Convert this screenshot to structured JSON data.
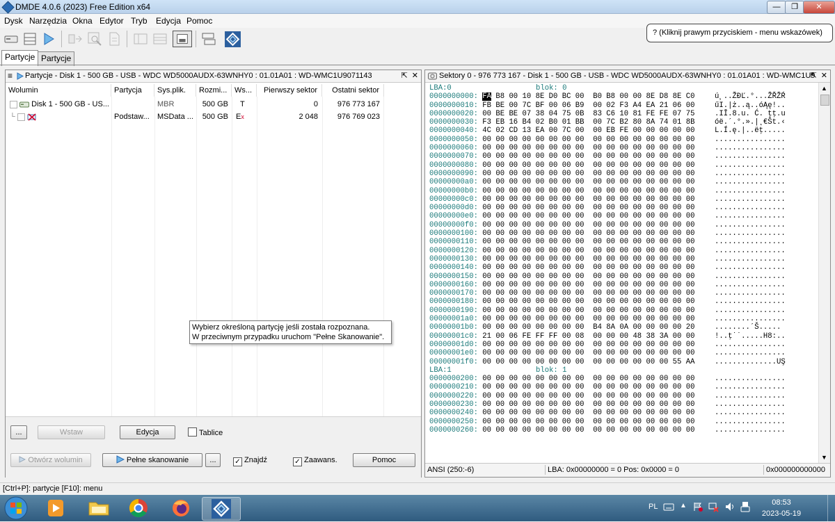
{
  "window": {
    "title": "DMDE 4.0.6 (2023) Free Edition x64",
    "close_label": "✕",
    "min_label": "—",
    "max_label": "❐"
  },
  "menu": [
    "Dysk",
    "Narzędzia",
    "Okna",
    "Edytor",
    "Tryb",
    "Edycja",
    "Pomoc"
  ],
  "hint": "? (Kliknij prawym przyciskiem - menu wskazówek)",
  "tabs": [
    "Partycje",
    "Partycje"
  ],
  "left_panel": {
    "title": "Partycje - Disk 1 - 500 GB - USB - WDC WD5000AUDX-63WNHY0 : 01.01A01 : WD-WMC1U9071143",
    "columns": [
      "Wolumin",
      "Partycja",
      "Sys.plik.",
      "Rozmi...",
      "Ws...",
      "Pierwszy sektor",
      "Ostatni sektor"
    ],
    "rows": [
      {
        "volume": "Disk 1 - 500 GB - US...",
        "partition": "",
        "fs": "MBR",
        "size": "500 GB",
        "ws": "T",
        "first": "0",
        "last": "976 773 167"
      },
      {
        "volume": "",
        "partition": "Podstaw...",
        "fs": "MSData ...",
        "size": "500 GB",
        "ws": "E",
        "ws_mark": "x",
        "first": "2 048",
        "last": "976 769 023"
      }
    ],
    "buttons": {
      "more1": "...",
      "insert": "Wstaw",
      "edit": "Edycja",
      "tables": "Tablice",
      "open_volume": "Otwórz wolumin",
      "full_scan": "Pełne skanowanie",
      "more2": "...",
      "find": "Znajdź",
      "advanced": "Zaawans.",
      "help": "Pomoc"
    }
  },
  "tooltip": {
    "line1": "Wybierz określoną partycję jeśli została rozpoznana.",
    "line2": "W przeciwnym przypadku uruchom \"Pełne Skanowanie\"."
  },
  "right_panel": {
    "title": "Sektory 0 - 976 773 167 - Disk 1 - 500 GB - USB - WDC WD5000AUDX-63WNHY0 : 01.01A01 : WD-WMC1U9...",
    "lba0_label": "LBA:0",
    "blok0_label": "blok: 0",
    "lba1_label": "LBA:1",
    "blok1_label": "blok: 1",
    "hex_rows": [
      {
        "off": "0000000000:",
        "hex": "FA B8 00 10 8E D0 BC 00  B0 B8 00 00 8E D8 8E C0",
        "ascii": "ú¸..ŽĐĽ.°...ŽŘŽŔ"
      },
      {
        "off": "0000000010:",
        "hex": "FB BE 00 7C BF 00 06 B9  00 02 F3 A4 EA 21 06 00",
        "ascii": "űI.|ż..ą..óĄę!.."
      },
      {
        "off": "0000000020:",
        "hex": "00 BE BE 07 38 04 75 0B  83 C6 10 81 FE FE 07 75",
        "ascii": ".IĪ.8.u. Ć. ţţ.u"
      },
      {
        "off": "0000000030:",
        "hex": "F3 EB 16 B4 02 B0 01 BB  00 7C B2 80 8A 74 01 8B",
        "ascii": "óë.´.°.».|˛€Št.‹"
      },
      {
        "off": "0000000040:",
        "hex": "4C 02 CD 13 EA 00 7C 00  00 EB FE 00 00 00 00 00",
        "ascii": "L.Í.ę.|..ëţ....."
      },
      {
        "off": "0000000050:",
        "hex": "00 00 00 00 00 00 00 00  00 00 00 00 00 00 00 00",
        "ascii": "................"
      },
      {
        "off": "0000000060:",
        "hex": "00 00 00 00 00 00 00 00  00 00 00 00 00 00 00 00",
        "ascii": "................"
      },
      {
        "off": "0000000070:",
        "hex": "00 00 00 00 00 00 00 00  00 00 00 00 00 00 00 00",
        "ascii": "................"
      },
      {
        "off": "0000000080:",
        "hex": "00 00 00 00 00 00 00 00  00 00 00 00 00 00 00 00",
        "ascii": "................"
      },
      {
        "off": "0000000090:",
        "hex": "00 00 00 00 00 00 00 00  00 00 00 00 00 00 00 00",
        "ascii": "................"
      },
      {
        "off": "00000000a0:",
        "hex": "00 00 00 00 00 00 00 00  00 00 00 00 00 00 00 00",
        "ascii": "................"
      },
      {
        "off": "00000000b0:",
        "hex": "00 00 00 00 00 00 00 00  00 00 00 00 00 00 00 00",
        "ascii": "................"
      },
      {
        "off": "00000000c0:",
        "hex": "00 00 00 00 00 00 00 00  00 00 00 00 00 00 00 00",
        "ascii": "................"
      },
      {
        "off": "00000000d0:",
        "hex": "00 00 00 00 00 00 00 00  00 00 00 00 00 00 00 00",
        "ascii": "................"
      },
      {
        "off": "00000000e0:",
        "hex": "00 00 00 00 00 00 00 00  00 00 00 00 00 00 00 00",
        "ascii": "................"
      },
      {
        "off": "00000000f0:",
        "hex": "00 00 00 00 00 00 00 00  00 00 00 00 00 00 00 00",
        "ascii": "................"
      },
      {
        "off": "0000000100:",
        "hex": "00 00 00 00 00 00 00 00  00 00 00 00 00 00 00 00",
        "ascii": "................"
      },
      {
        "off": "0000000110:",
        "hex": "00 00 00 00 00 00 00 00  00 00 00 00 00 00 00 00",
        "ascii": "................"
      },
      {
        "off": "0000000120:",
        "hex": "00 00 00 00 00 00 00 00  00 00 00 00 00 00 00 00",
        "ascii": "................"
      },
      {
        "off": "0000000130:",
        "hex": "00 00 00 00 00 00 00 00  00 00 00 00 00 00 00 00",
        "ascii": "................"
      },
      {
        "off": "0000000140:",
        "hex": "00 00 00 00 00 00 00 00  00 00 00 00 00 00 00 00",
        "ascii": "................"
      },
      {
        "off": "0000000150:",
        "hex": "00 00 00 00 00 00 00 00  00 00 00 00 00 00 00 00",
        "ascii": "................"
      },
      {
        "off": "0000000160:",
        "hex": "00 00 00 00 00 00 00 00  00 00 00 00 00 00 00 00",
        "ascii": "................"
      },
      {
        "off": "0000000170:",
        "hex": "00 00 00 00 00 00 00 00  00 00 00 00 00 00 00 00",
        "ascii": "................"
      },
      {
        "off": "0000000180:",
        "hex": "00 00 00 00 00 00 00 00  00 00 00 00 00 00 00 00",
        "ascii": "................"
      },
      {
        "off": "0000000190:",
        "hex": "00 00 00 00 00 00 00 00  00 00 00 00 00 00 00 00",
        "ascii": "................"
      },
      {
        "off": "00000001a0:",
        "hex": "00 00 00 00 00 00 00 00  00 00 00 00 00 00 00 00",
        "ascii": "................"
      },
      {
        "off": "00000001b0:",
        "hex": "00 00 00 00 00 00 00 00  B4 8A 0A 00 00 00 00 20",
        "ascii": "........´Š..... "
      },
      {
        "off": "00000001c0:",
        "hex": "21 00 06 FE FF FF 00 08  00 00 00 48 38 3A 00 00",
        "ascii": "!..ţ˙˙.....H8:.."
      },
      {
        "off": "00000001d0:",
        "hex": "00 00 00 00 00 00 00 00  00 00 00 00 00 00 00 00",
        "ascii": "................"
      },
      {
        "off": "00000001e0:",
        "hex": "00 00 00 00 00 00 00 00  00 00 00 00 00 00 00 00",
        "ascii": "................"
      },
      {
        "off": "00000001f0:",
        "hex": "00 00 00 00 00 00 00 00  00 00 00 00 00 00 55 AA",
        "ascii": "..............UŞ"
      }
    ],
    "hex_rows_2": [
      {
        "off": "0000000200:",
        "hex": "00 00 00 00 00 00 00 00  00 00 00 00 00 00 00 00",
        "ascii": "................"
      },
      {
        "off": "0000000210:",
        "hex": "00 00 00 00 00 00 00 00  00 00 00 00 00 00 00 00",
        "ascii": "................"
      },
      {
        "off": "0000000220:",
        "hex": "00 00 00 00 00 00 00 00  00 00 00 00 00 00 00 00",
        "ascii": "................"
      },
      {
        "off": "0000000230:",
        "hex": "00 00 00 00 00 00 00 00  00 00 00 00 00 00 00 00",
        "ascii": "................"
      },
      {
        "off": "0000000240:",
        "hex": "00 00 00 00 00 00 00 00  00 00 00 00 00 00 00 00",
        "ascii": "................"
      },
      {
        "off": "0000000250:",
        "hex": "00 00 00 00 00 00 00 00  00 00 00 00 00 00 00 00",
        "ascii": "................"
      },
      {
        "off": "0000000260:",
        "hex": "00 00 00 00 00 00 00 00  00 00 00 00 00 00 00 00",
        "ascii": "................"
      }
    ],
    "status": {
      "encoding": "ANSI (250:-6)",
      "position": "LBA: 0x00000000 = 0  Pos: 0x0000 = 0",
      "offset": "0x000000000000"
    }
  },
  "statusbar": "[Ctrl+P]: partycje  [F10]: menu",
  "tray": {
    "lang": "PL",
    "time": "08:53",
    "date": "2023-05-19"
  },
  "colors": {
    "accent": "#2a6bb3",
    "hex_offset": "#1b7a7a",
    "taskbar": "#2f5b7f"
  }
}
